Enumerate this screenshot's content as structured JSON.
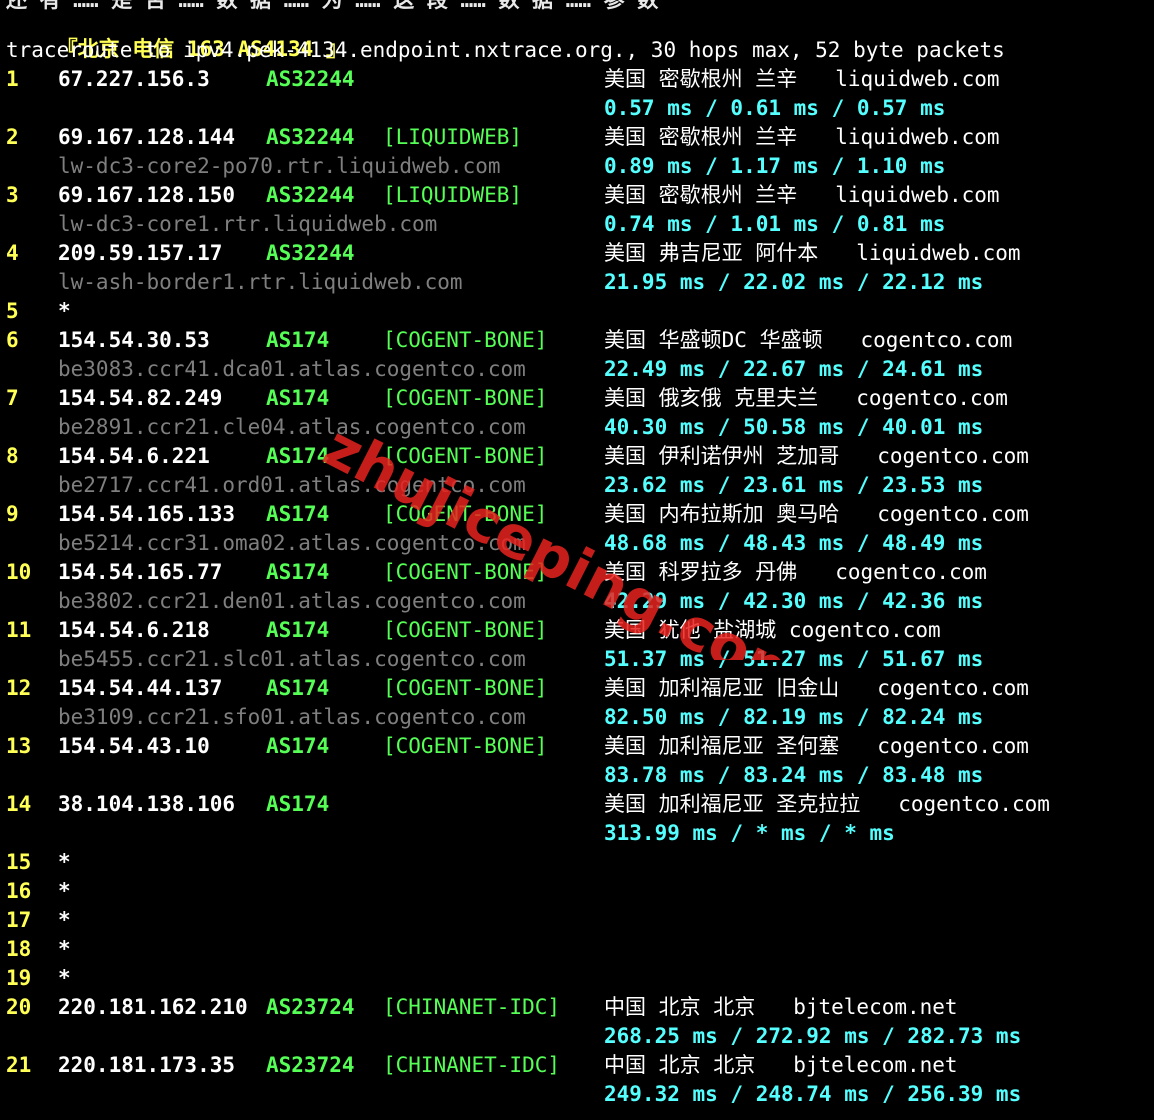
{
  "header": {
    "cut_line": "还 有 …… 是 否 …… 数 据 …… 为 …… 这 段 …… 数 据 …… 参 数",
    "provider_open": "『北京 电信 ",
    "provider_asn": "163 AS4134",
    "provider_close": " 』",
    "command": "traceroute to ipv4.pek-4134.endpoint.nxtrace.org., 30 hops max, 52 byte packets"
  },
  "hops": [
    {
      "n": "1",
      "ip": "67.227.156.3",
      "asn": "AS32244",
      "tag": "",
      "geo": "美国 密歇根州 兰辛   liquidweb.com",
      "host": "",
      "rtt": "0.57 ms / 0.61 ms / 0.57 ms"
    },
    {
      "n": "2",
      "ip": "69.167.128.144",
      "asn": "AS32244",
      "tag": "[LIQUIDWEB]",
      "geo": "美国 密歇根州 兰辛   liquidweb.com",
      "host": "lw-dc3-core2-po70.rtr.liquidweb.com",
      "rtt": "0.89 ms / 1.17 ms / 1.10 ms"
    },
    {
      "n": "3",
      "ip": "69.167.128.150",
      "asn": "AS32244",
      "tag": "[LIQUIDWEB]",
      "geo": "美国 密歇根州 兰辛   liquidweb.com",
      "host": "lw-dc3-core1.rtr.liquidweb.com",
      "rtt": "0.74 ms / 1.01 ms / 0.81 ms"
    },
    {
      "n": "4",
      "ip": "209.59.157.17",
      "asn": "AS32244",
      "tag": "",
      "geo": "美国 弗吉尼亚 阿什本   liquidweb.com",
      "host": "lw-ash-border1.rtr.liquidweb.com",
      "rtt": "21.95 ms / 22.02 ms / 22.12 ms"
    },
    {
      "n": "5",
      "star": "*"
    },
    {
      "n": "6",
      "ip": "154.54.30.53",
      "asn": "AS174",
      "tag": "[COGENT-BONE]",
      "geo": "美国 华盛顿DC 华盛顿   cogentco.com",
      "host": "be3083.ccr41.dca01.atlas.cogentco.com",
      "rtt": "22.49 ms / 22.67 ms / 24.61 ms"
    },
    {
      "n": "7",
      "ip": "154.54.82.249",
      "asn": "AS174",
      "tag": "[COGENT-BONE]",
      "geo": "美国 俄亥俄 克里夫兰   cogentco.com",
      "host": "be2891.ccr21.cle04.atlas.cogentco.com",
      "rtt": "40.30 ms / 50.58 ms / 40.01 ms"
    },
    {
      "n": "8",
      "ip": "154.54.6.221",
      "asn": "AS174",
      "tag": "[COGENT-BONE]",
      "geo": "美国 伊利诺伊州 芝加哥   cogentco.com",
      "host": "be2717.ccr41.ord01.atlas.cogentco.com",
      "rtt": "23.62 ms / 23.61 ms / 23.53 ms"
    },
    {
      "n": "9",
      "ip": "154.54.165.133",
      "asn": "AS174",
      "tag": "[COGENT-BONE]",
      "geo": "美国 内布拉斯加 奥马哈   cogentco.com",
      "host": "be5214.ccr31.oma02.atlas.cogentco.com",
      "rtt": "48.68 ms / 48.43 ms / 48.49 ms"
    },
    {
      "n": "10",
      "ip": "154.54.165.77",
      "asn": "AS174",
      "tag": "[COGENT-BONE]",
      "geo": "美国 科罗拉多 丹佛   cogentco.com",
      "host": "be3802.ccr21.den01.atlas.cogentco.com",
      "rtt": "42.29 ms / 42.30 ms / 42.36 ms"
    },
    {
      "n": "11",
      "ip": "154.54.6.218",
      "asn": "AS174",
      "tag": "[COGENT-BONE]",
      "geo": "美国 犹他 盐湖城 cogentco.com",
      "host": "be5455.ccr21.slc01.atlas.cogentco.com",
      "rtt": "51.37 ms / 51.27 ms / 51.67 ms"
    },
    {
      "n": "12",
      "ip": "154.54.44.137",
      "asn": "AS174",
      "tag": "[COGENT-BONE]",
      "geo": "美国 加利福尼亚 旧金山   cogentco.com",
      "host": "be3109.ccr21.sfo01.atlas.cogentco.com",
      "rtt": "82.50 ms / 82.19 ms / 82.24 ms"
    },
    {
      "n": "13",
      "ip": "154.54.43.10",
      "asn": "AS174",
      "tag": "[COGENT-BONE]",
      "geo": "美国 加利福尼亚 圣何塞   cogentco.com",
      "host": "",
      "rtt": "83.78 ms / 83.24 ms / 83.48 ms"
    },
    {
      "n": "14",
      "ip": "38.104.138.106",
      "asn": "AS174",
      "tag": "",
      "geo": "美国 加利福尼亚 圣克拉拉   cogentco.com",
      "host": "",
      "rtt": "313.99 ms / * ms / * ms"
    },
    {
      "n": "15",
      "star": "*"
    },
    {
      "n": "16",
      "star": "*"
    },
    {
      "n": "17",
      "star": "*"
    },
    {
      "n": "18",
      "star": "*"
    },
    {
      "n": "19",
      "star": "*"
    },
    {
      "n": "20",
      "ip": "220.181.162.210",
      "asn": "AS23724",
      "tag": "[CHINANET-IDC]",
      "geo": "中国 北京 北京   bjtelecom.net",
      "host": "",
      "rtt": "268.25 ms / 272.92 ms / 282.73 ms"
    },
    {
      "n": "21",
      "ip": "220.181.173.35",
      "asn": "AS23724",
      "tag": "[CHINANET-IDC]",
      "geo": "中国 北京 北京   bjtelecom.net",
      "host": "",
      "rtt": "249.32 ms / 248.74 ms / 256.39 ms"
    }
  ],
  "watermark": {
    "text": "zhujiceping.com",
    "color": "#e8231f"
  },
  "colors": {
    "background": "#000000",
    "hop_number": "#ffff55",
    "ip": "#ffffff",
    "asn": "#55ff55",
    "hostname": "#7f7f7f",
    "rtt": "#55ffff"
  }
}
